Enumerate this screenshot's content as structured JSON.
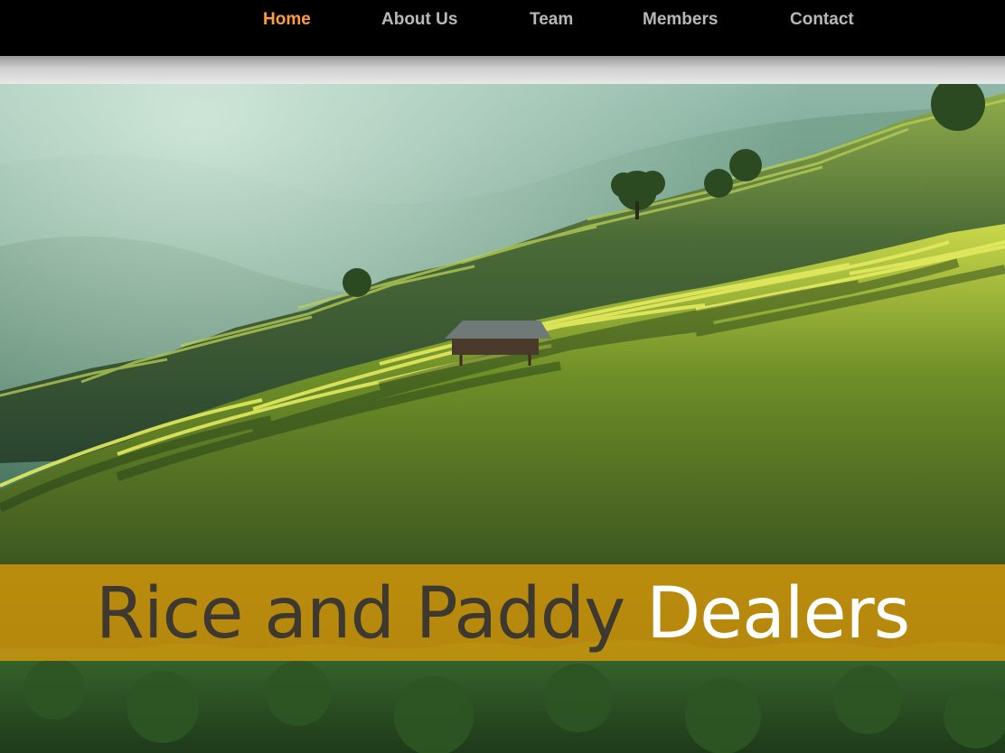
{
  "nav": {
    "items": [
      {
        "label": "Home",
        "active": true
      },
      {
        "label": "About Us",
        "active": false
      },
      {
        "label": "Team",
        "active": false
      },
      {
        "label": "Members",
        "active": false
      },
      {
        "label": "Contact",
        "active": false
      }
    ]
  },
  "hero": {
    "tagline_dark": "Rice and Paddy",
    "tagline_light": "Dealers",
    "banner_color": "#d6990a"
  },
  "colors": {
    "nav_background": "#000000",
    "nav_text": "#b8b8b8",
    "nav_active": "#ff9d3d"
  }
}
